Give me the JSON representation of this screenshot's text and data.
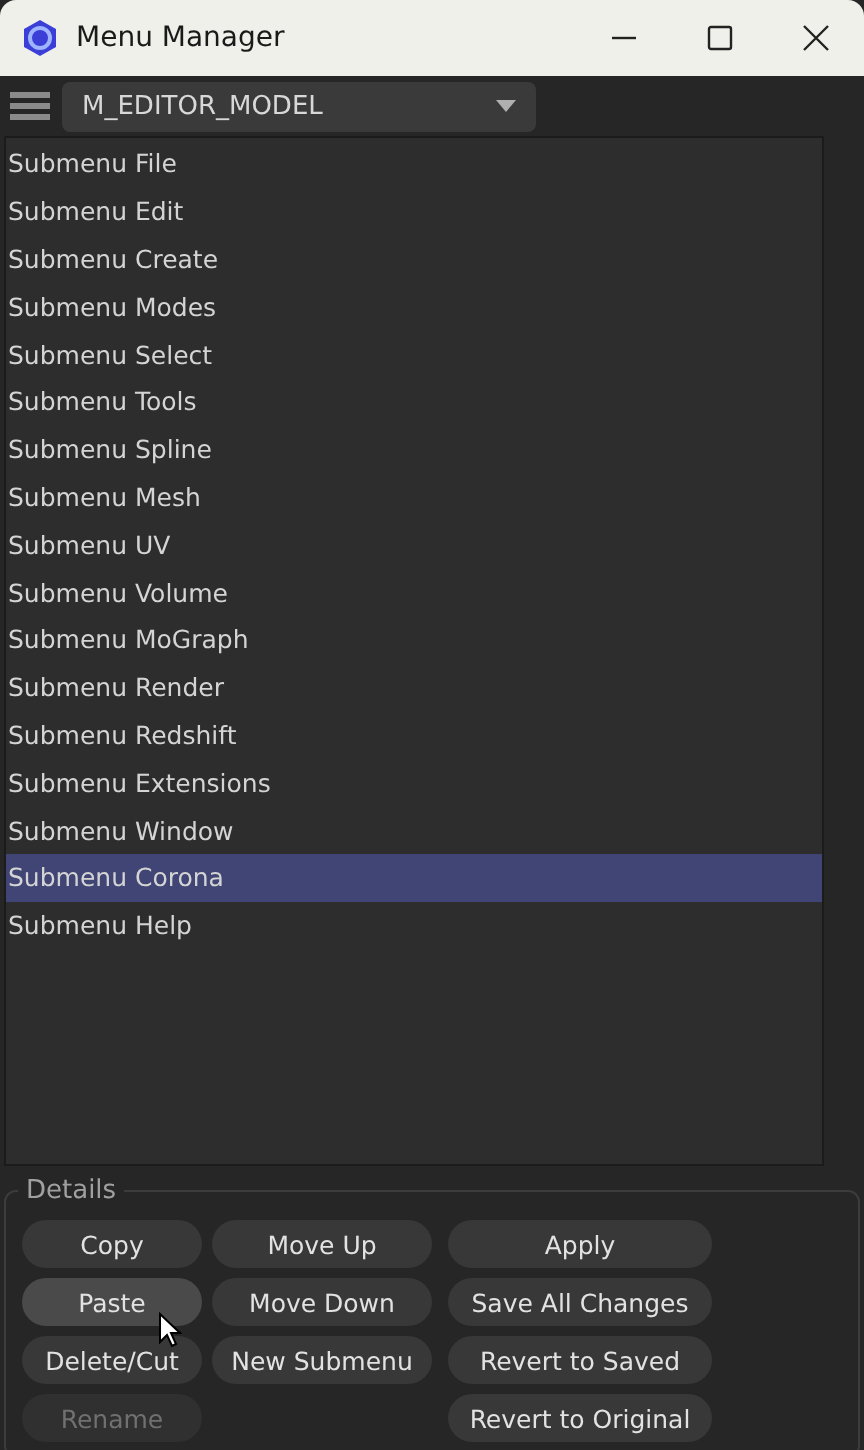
{
  "window": {
    "title": "Menu Manager"
  },
  "toolbar": {
    "dropdown": {
      "value": "M_EDITOR_MODEL"
    }
  },
  "menu_list": {
    "items": [
      {
        "label": "Submenu File",
        "selected": false
      },
      {
        "label": "Submenu Edit",
        "selected": false
      },
      {
        "label": "Submenu Create",
        "selected": false
      },
      {
        "label": "Submenu Modes",
        "selected": false
      },
      {
        "label": "Submenu Select",
        "selected": false
      },
      {
        "label": "Submenu Tools",
        "selected": false
      },
      {
        "label": "Submenu Spline",
        "selected": false
      },
      {
        "label": "Submenu Mesh",
        "selected": false
      },
      {
        "label": "Submenu UV",
        "selected": false
      },
      {
        "label": "Submenu Volume",
        "selected": false
      },
      {
        "label": "Submenu MoGraph",
        "selected": false
      },
      {
        "label": "Submenu Render",
        "selected": false
      },
      {
        "label": "Submenu Redshift",
        "selected": false
      },
      {
        "label": "Submenu Extensions",
        "selected": false
      },
      {
        "label": "Submenu Window",
        "selected": false
      },
      {
        "label": "Submenu Corona",
        "selected": true
      },
      {
        "label": "Submenu Help",
        "selected": false
      }
    ]
  },
  "details": {
    "title": "Details",
    "columns": [
      [
        {
          "label": "Copy",
          "disabled": false,
          "hovered": false
        },
        {
          "label": "Paste",
          "disabled": false,
          "hovered": true
        },
        {
          "label": "Delete/Cut",
          "disabled": false,
          "hovered": false
        },
        {
          "label": "Rename",
          "disabled": true,
          "hovered": false
        }
      ],
      [
        {
          "label": "Move Up",
          "disabled": false,
          "hovered": false
        },
        {
          "label": "Move Down",
          "disabled": false,
          "hovered": false
        },
        {
          "label": "New Submenu",
          "disabled": false,
          "hovered": false
        }
      ],
      [
        {
          "label": "Apply",
          "disabled": false,
          "hovered": false
        },
        {
          "label": "Save All Changes",
          "disabled": false,
          "hovered": false
        },
        {
          "label": "Revert to Saved",
          "disabled": false,
          "hovered": false
        },
        {
          "label": "Revert to Original",
          "disabled": false,
          "hovered": false
        }
      ]
    ]
  }
}
